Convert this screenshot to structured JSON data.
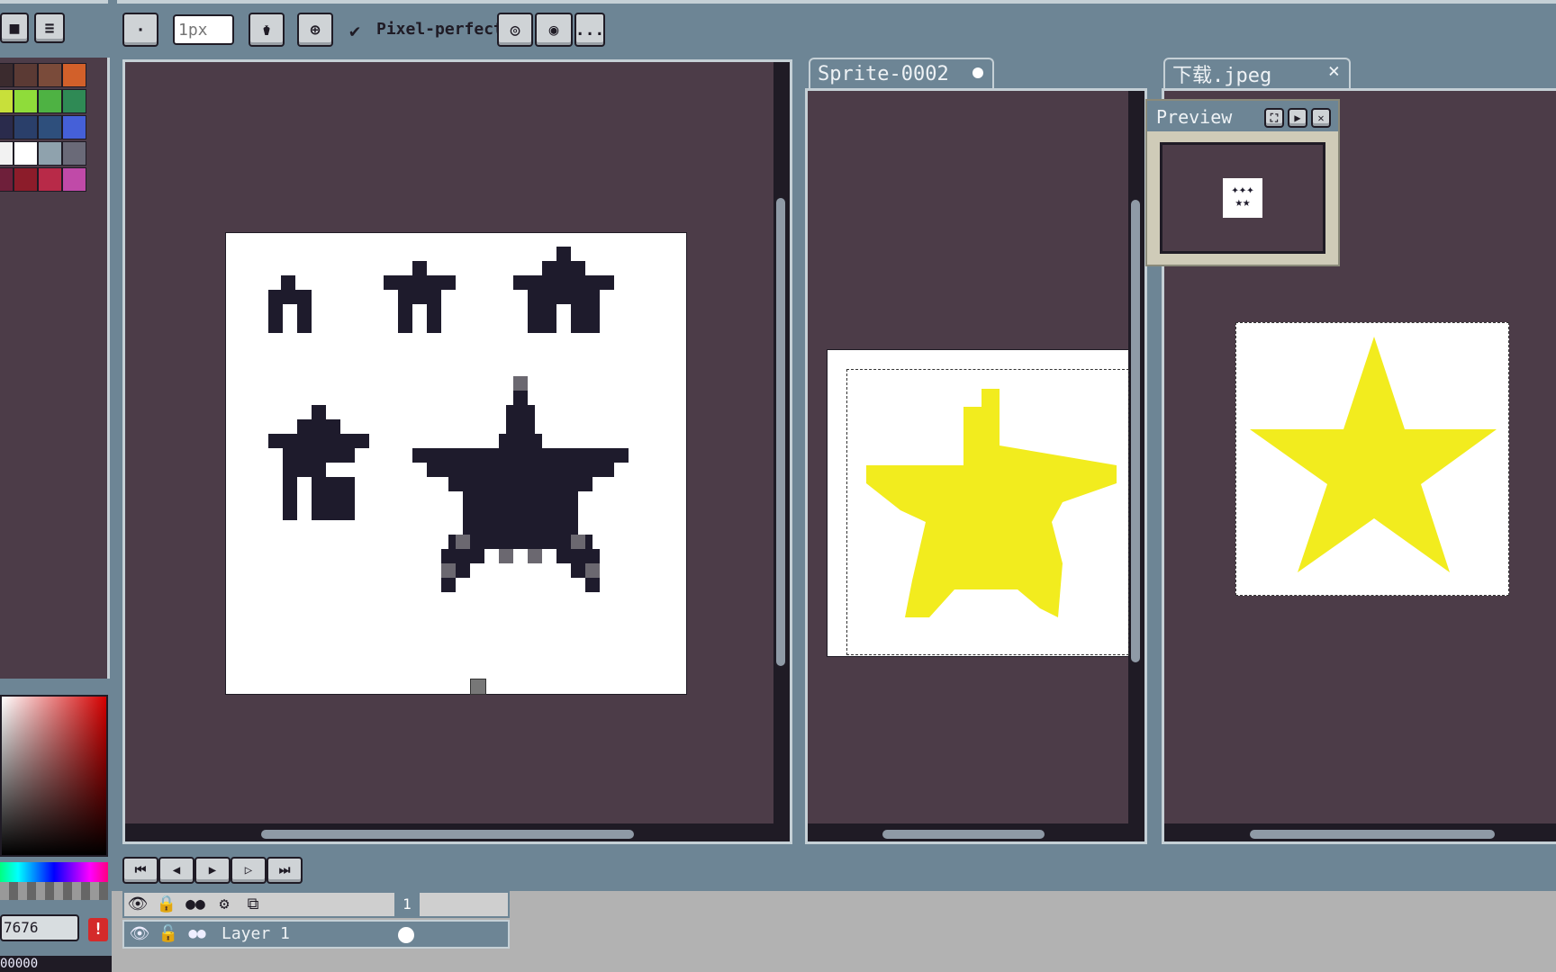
{
  "toolbar": {
    "brush_size_placeholder": "1px",
    "pixel_perfect_label": "Pixel-perfect",
    "more_label": "..."
  },
  "tabs": [
    {
      "label": "Sprite-0002"
    },
    {
      "label": "下载.jpeg",
      "close": "×"
    }
  ],
  "preview": {
    "title": "Preview"
  },
  "palette": {
    "colors": [
      "#3b2b2e",
      "#5b3a34",
      "#7a4b3a",
      "#d2602a",
      "#c8e03a",
      "#8fdc3a",
      "#4eb243",
      "#2f8a55",
      "#2a2b4c",
      "#2a3f6a",
      "#2e4f7c",
      "#4560d8",
      "#f2f2f2",
      "#ffffff",
      "#8fa2ad",
      "#6a6a78",
      "#6e1f3a",
      "#8c1c2a",
      "#b82a48",
      "#c04aa8"
    ]
  },
  "color_bar": {
    "fg_hex": "7676",
    "bg_hex": "00000"
  },
  "timeline": {
    "frame_number": "1",
    "layer_name": "Layer 1"
  },
  "colors": {
    "canvas_bg": "#4c3c48",
    "ui_bg": "#6d8595",
    "star_dark": "#1e1b2c",
    "star_yellow": "#f2ec1e"
  }
}
